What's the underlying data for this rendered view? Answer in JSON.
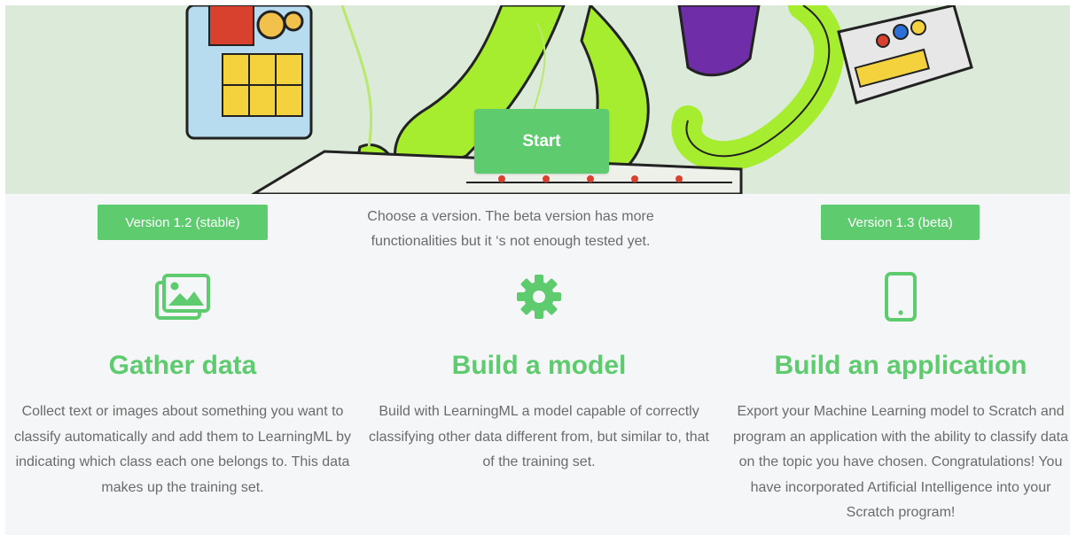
{
  "hero": {
    "start_label": "Start"
  },
  "versions": {
    "stable_label": "Version 1.2 (stable)",
    "beta_label": "Version 1.3 (beta)",
    "note": "Choose a version. The beta version has more functionalities but it ‘s not enough tested yet."
  },
  "features": [
    {
      "icon": "images-icon",
      "title": "Gather data",
      "text": "Collect text or images about something you want to classify automatically and add them to LearningML by indicating which class each one belongs to. This data makes up the training set."
    },
    {
      "icon": "gear-icon",
      "title": "Build a model",
      "text": "Build with LearningML a model capable of correctly classifying other data different from, but similar to, that of the training set."
    },
    {
      "icon": "mobile-phone-icon",
      "title": "Build an application",
      "text": "Export your Machine Learning model to Scratch and program an application with the ability to classify data on the topic you have chosen. Congratulations! You have incorporated Artificial Intelligence into your Scratch program!"
    }
  ],
  "colors": {
    "accent": "#5ecb6e",
    "hero_bg": "#dcead9",
    "panel_bg": "#f5f6f8",
    "body_text": "#6b6b6b"
  }
}
